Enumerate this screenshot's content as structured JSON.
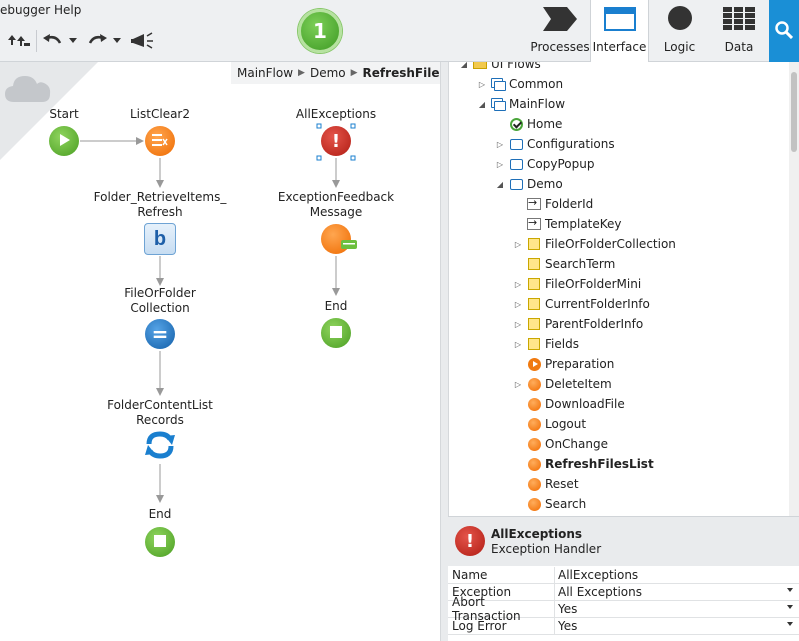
{
  "menu": {
    "debugger": "ebugger",
    "help": "Help"
  },
  "publish": {
    "count": "1"
  },
  "tabs": [
    {
      "label": "Processes",
      "icon": "processes-icon"
    },
    {
      "label": "Interface",
      "icon": "interface-icon",
      "active": true
    },
    {
      "label": "Logic",
      "icon": "logic-icon"
    },
    {
      "label": "Data",
      "icon": "data-icon"
    }
  ],
  "breadcrumb": {
    "part1": "MainFlow",
    "part2": "Demo",
    "current": "RefreshFilesList"
  },
  "flow": {
    "start": "Start",
    "listclear": "ListClear2",
    "retrieve_line1": "Folder_RetrieveItems_",
    "retrieve_line2": "Refresh",
    "assign_line1": "FileOrFolder",
    "assign_line2": "Collection",
    "refresh_line1": "FolderContentList",
    "refresh_line2": "Records",
    "end1": "End",
    "allexceptions": "AllExceptions",
    "feedback_line1": "ExceptionFeedback",
    "feedback_line2": "Message",
    "end2": "End",
    "aggregate_glyph": "b",
    "assign_glyph": "=",
    "exception_glyph": "!"
  },
  "tree": {
    "rows": [
      {
        "label": "UI Flows",
        "icon": "folder",
        "arrow": "◢"
      },
      {
        "label": "Common",
        "icon": "uiflow",
        "arrow": "▷"
      },
      {
        "label": "MainFlow",
        "icon": "uiflow",
        "arrow": "◢"
      },
      {
        "label": "Home",
        "icon": "home",
        "arrow": ""
      },
      {
        "label": "Configurations",
        "icon": "screen",
        "arrow": "▷"
      },
      {
        "label": "CopyPopup",
        "icon": "screen",
        "arrow": "▷"
      },
      {
        "label": "Demo",
        "icon": "screen",
        "arrow": "◢"
      },
      {
        "label": "FolderId",
        "icon": "input",
        "arrow": ""
      },
      {
        "label": "TemplateKey",
        "icon": "input",
        "arrow": ""
      },
      {
        "label": "FileOrFolderCollection",
        "icon": "local",
        "arrow": "▷"
      },
      {
        "label": "SearchTerm",
        "icon": "local",
        "arrow": ""
      },
      {
        "label": "FileOrFolderMini",
        "icon": "local",
        "arrow": "▷"
      },
      {
        "label": "CurrentFolderInfo",
        "icon": "local",
        "arrow": "▷"
      },
      {
        "label": "ParentFolderInfo",
        "icon": "local",
        "arrow": "▷"
      },
      {
        "label": "Fields",
        "icon": "local",
        "arrow": "▷"
      },
      {
        "label": "Preparation",
        "icon": "prep",
        "arrow": ""
      },
      {
        "label": "DeleteItem",
        "icon": "action",
        "arrow": "▷"
      },
      {
        "label": "DownloadFile",
        "icon": "action",
        "arrow": ""
      },
      {
        "label": "Logout",
        "icon": "action",
        "arrow": ""
      },
      {
        "label": "OnChange",
        "icon": "action",
        "arrow": ""
      },
      {
        "label": "RefreshFilesList",
        "icon": "action",
        "arrow": "",
        "bold": true
      },
      {
        "label": "Reset",
        "icon": "action",
        "arrow": ""
      },
      {
        "label": "Search",
        "icon": "action",
        "arrow": ""
      }
    ]
  },
  "props": {
    "title": "AllExceptions",
    "subtitle": "Exception Handler",
    "icon_glyph": "!",
    "rows": [
      {
        "name": "Name",
        "value": "AllExceptions",
        "dropdown": false
      },
      {
        "name": "Exception",
        "value": "All Exceptions",
        "dropdown": true
      },
      {
        "name": "Abort Transaction",
        "value": "Yes",
        "dropdown": true
      },
      {
        "name": "Log Error",
        "value": "Yes",
        "dropdown": true
      }
    ]
  }
}
